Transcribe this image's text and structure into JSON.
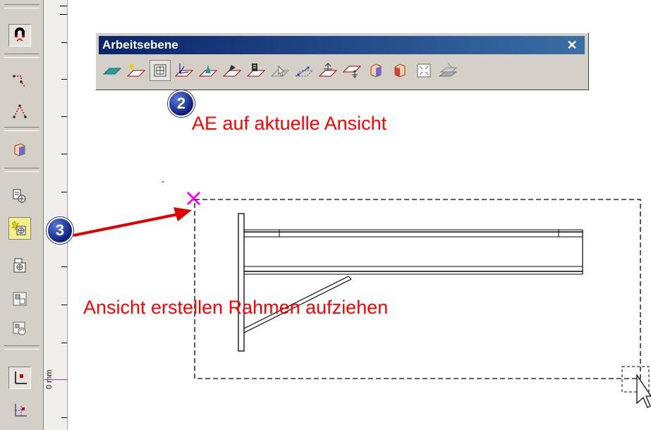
{
  "palette": {
    "title": "Arbeitsebene",
    "close_label": "✕",
    "buttons": [
      "plane-icon",
      "plane-point-icon",
      "plane-view-icon",
      "plane-axis-icon",
      "plane-solid-icon",
      "plane-rotate-icon",
      "plane-book-icon",
      "plane-pick-icon",
      "plane-line-icon",
      "plane-move-icon",
      "plane-origin-icon",
      "cube-face-icon",
      "cube-side-icon",
      "fit-view-icon",
      "plane-stack-icon"
    ]
  },
  "left_toolbar": {
    "buttons": [
      "magnet-icon",
      "point-icon",
      "angle-icon",
      "cube-icon",
      "view-list-icon",
      "new-view-icon",
      "view-camera-icon",
      "view-image-icon",
      "view-rotate-icon",
      "axis-icon",
      "axis-grid-icon"
    ]
  },
  "ruler": {
    "unit_label": "0 mm"
  },
  "annotations": {
    "badge_2": "2",
    "badge_3": "3",
    "text_ae": "AE auf aktuelle Ansicht",
    "text_ansicht": "Ansicht erstellen  Rahmen aufziehen"
  },
  "colors": {
    "annotation": "#ff0000",
    "marker": "#ff00ff",
    "title_bar": "#0a246a"
  }
}
